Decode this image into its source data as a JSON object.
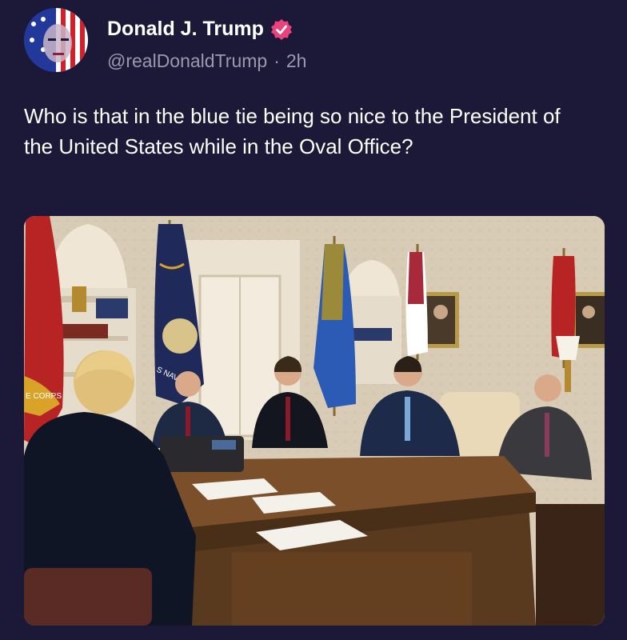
{
  "author": {
    "display_name": "Donald J. Trump",
    "handle": "@realDonaldTrump",
    "separator": "·",
    "time_ago": "2h",
    "verified": true,
    "verified_color": "#e8437a"
  },
  "tweet": {
    "text": "Who is that in the blue tie being so nice to the President of the United States while in the Oval Office?"
  },
  "media": {
    "type": "photo",
    "subject": "oval-office-meeting",
    "flag_text_1": "S NAVY",
    "flag_text_2": "E CORPS"
  },
  "colors": {
    "background": "#1b1838",
    "text_primary": "#ffffff",
    "text_secondary": "#9a9aae"
  }
}
